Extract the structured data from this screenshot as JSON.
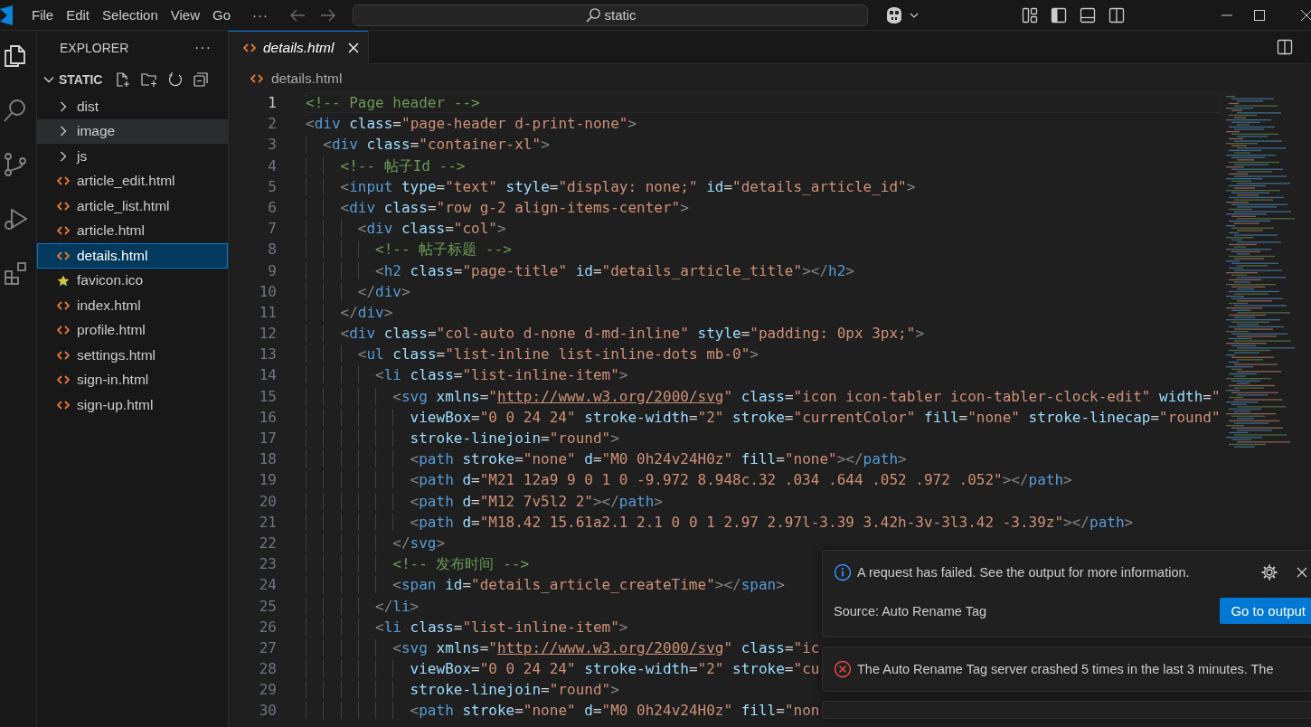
{
  "title_bar": {
    "menu": [
      "File",
      "Edit",
      "Selection",
      "View",
      "Go"
    ],
    "menu_overflow": "···",
    "search": {
      "value": "static"
    }
  },
  "activity_bar": [
    {
      "kind": "files",
      "selected": true
    },
    {
      "kind": "search",
      "selected": false
    },
    {
      "kind": "source-control",
      "selected": false
    },
    {
      "kind": "run",
      "selected": false
    },
    {
      "kind": "extensions",
      "selected": false
    }
  ],
  "explorer": {
    "title": "EXPLORER",
    "more": "···",
    "section": {
      "name": "STATIC",
      "expanded": true,
      "items": [
        {
          "kind": "folder",
          "label": "dist",
          "expanded": false,
          "selected": false,
          "hovered": false
        },
        {
          "kind": "folder",
          "label": "image",
          "expanded": false,
          "selected": false,
          "hovered": true
        },
        {
          "kind": "folder",
          "label": "js",
          "expanded": false,
          "selected": false,
          "hovered": false
        },
        {
          "kind": "html",
          "label": "article_edit.html",
          "selected": false,
          "hovered": false
        },
        {
          "kind": "html",
          "label": "article_list.html",
          "selected": false,
          "hovered": false
        },
        {
          "kind": "html",
          "label": "article.html",
          "selected": false,
          "hovered": false
        },
        {
          "kind": "html",
          "label": "details.html",
          "selected": true,
          "hovered": false
        },
        {
          "kind": "favicon",
          "label": "favicon.ico",
          "selected": false,
          "hovered": false
        },
        {
          "kind": "html",
          "label": "index.html",
          "selected": false,
          "hovered": false
        },
        {
          "kind": "html",
          "label": "profile.html",
          "selected": false,
          "hovered": false
        },
        {
          "kind": "html",
          "label": "settings.html",
          "selected": false,
          "hovered": false
        },
        {
          "kind": "html",
          "label": "sign-in.html",
          "selected": false,
          "hovered": false
        },
        {
          "kind": "html",
          "label": "sign-up.html",
          "selected": false,
          "hovered": false
        }
      ]
    }
  },
  "tabs": [
    {
      "kind": "html",
      "label": "details.html",
      "selected": true,
      "preview": true
    }
  ],
  "breadcrumb": [
    {
      "kind": "html",
      "label": "details.html"
    }
  ],
  "editor": {
    "lines": [
      {
        "number": "1",
        "current": true,
        "text": "<!-- Page header -->"
      },
      {
        "number": "2",
        "current": false,
        "text": "<div class=\"page-header d-print-none\">"
      },
      {
        "number": "3",
        "current": false,
        "text": "  <div class=\"container-xl\">"
      },
      {
        "number": "4",
        "current": false,
        "text": "    <!-- 帖子Id -->"
      },
      {
        "number": "5",
        "current": false,
        "text": "    <input type=\"text\" style=\"display: none;\" id=\"details_article_id\">"
      },
      {
        "number": "6",
        "current": false,
        "text": "    <div class=\"row g-2 align-items-center\">"
      },
      {
        "number": "7",
        "current": false,
        "text": "      <div class=\"col\">"
      },
      {
        "number": "8",
        "current": false,
        "text": "        <!-- 帖子标题 -->"
      },
      {
        "number": "9",
        "current": false,
        "text": "        <h2 class=\"page-title\" id=\"details_article_title\"></h2>"
      },
      {
        "number": "10",
        "current": false,
        "text": "      </div>"
      },
      {
        "number": "11",
        "current": false,
        "text": "    </div>"
      },
      {
        "number": "12",
        "current": false,
        "text": "    <div class=\"col-auto d-none d-md-inline\" style=\"padding: 0px 3px;\">"
      },
      {
        "number": "13",
        "current": false,
        "text": "      <ul class=\"list-inline list-inline-dots mb-0\">"
      },
      {
        "number": "14",
        "current": false,
        "text": "        <li class=\"list-inline-item\">"
      },
      {
        "number": "15",
        "current": false,
        "text": "          <svg xmlns=\"http://www.w3.org/2000/svg\" class=\"icon icon-tabler icon-tabler-clock-edit\" width=\""
      },
      {
        "number": "16",
        "current": false,
        "text": "            viewBox=\"0 0 24 24\" stroke-width=\"2\" stroke=\"currentColor\" fill=\"none\" stroke-linecap=\"round\""
      },
      {
        "number": "17",
        "current": false,
        "text": "            stroke-linejoin=\"round\">"
      },
      {
        "number": "18",
        "current": false,
        "text": "            <path stroke=\"none\" d=\"M0 0h24v24H0z\" fill=\"none\"></path>"
      },
      {
        "number": "19",
        "current": false,
        "text": "            <path d=\"M21 12a9 9 0 1 0 -9.972 8.948c.32 .034 .644 .052 .972 .052\"></path>"
      },
      {
        "number": "20",
        "current": false,
        "text": "            <path d=\"M12 7v5l2 2\"></path>"
      },
      {
        "number": "21",
        "current": false,
        "text": "            <path d=\"M18.42 15.61a2.1 2.1 0 0 1 2.97 2.97l-3.39 3.42h-3v-3l3.42 -3.39z\"></path>"
      },
      {
        "number": "22",
        "current": false,
        "text": "          </svg>"
      },
      {
        "number": "23",
        "current": false,
        "text": "          <!-- 发布时间 -->"
      },
      {
        "number": "24",
        "current": false,
        "text": "          <span id=\"details_article_createTime\"></span>"
      },
      {
        "number": "25",
        "current": false,
        "text": "        </li>"
      },
      {
        "number": "26",
        "current": false,
        "text": "        <li class=\"list-inline-item\">"
      },
      {
        "number": "27",
        "current": false,
        "text": "          <svg xmlns=\"http://www.w3.org/2000/svg\" class=\"ic"
      },
      {
        "number": "28",
        "current": false,
        "text": "            viewBox=\"0 0 24 24\" stroke-width=\"2\" stroke=\"cu"
      },
      {
        "number": "29",
        "current": false,
        "text": "            stroke-linejoin=\"round\">"
      },
      {
        "number": "30",
        "current": false,
        "text": "            <path stroke=\"none\" d=\"M0 0h24v24H0z\" fill=\"non"
      }
    ]
  },
  "notifications": [
    {
      "kind": "info",
      "message": "A request has failed. See the output for more information.",
      "source": "Source: Auto Rename Tag",
      "button": "Go to output"
    },
    {
      "kind": "error",
      "message": "The Auto Rename Tag server crashed 5 times in the last 3 minutes. The"
    }
  ]
}
